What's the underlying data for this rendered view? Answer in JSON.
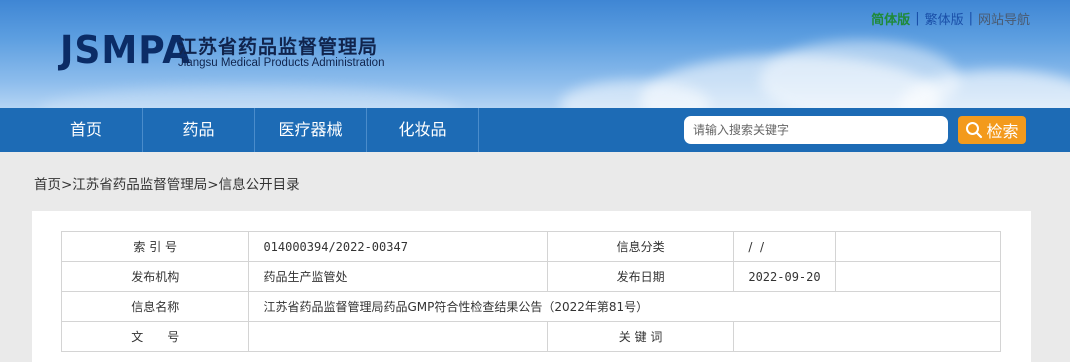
{
  "header": {
    "logo": "JSMPA",
    "title_cn": "江苏省药品监督管理局",
    "title_en": "Jiangsu Medical Products Administration",
    "links": {
      "simple": "简体版",
      "trad": "繁体版",
      "nav": "网站导航",
      "sep": "|"
    }
  },
  "nav": {
    "items": [
      "首页",
      "药品",
      "医疗器械",
      "化妆品"
    ]
  },
  "search": {
    "placeholder": "请输入搜索关键字",
    "button": "检索"
  },
  "breadcrumb": "首页>江苏省药品监督管理局>信息公开目录",
  "info": {
    "index_label": "索 引 号",
    "index_value": "014000394/2022-00347",
    "category_label": "信息分类",
    "category_value": "/  /",
    "org_label": "发布机构",
    "org_value": "药品生产监管处",
    "date_label": "发布日期",
    "date_value": "2022-09-20",
    "name_label": "信息名称",
    "name_value": "江苏省药品监督管理局药品GMP符合性检查结果公告（2022年第81号）",
    "doc_label": "文　　号",
    "doc_value": "",
    "keyword_label": "关 键 词",
    "keyword_value": ""
  },
  "colors": {
    "nav": "#1d6bb5",
    "search_button": "#f39a1c",
    "simple_link": "#1f8a3a"
  }
}
